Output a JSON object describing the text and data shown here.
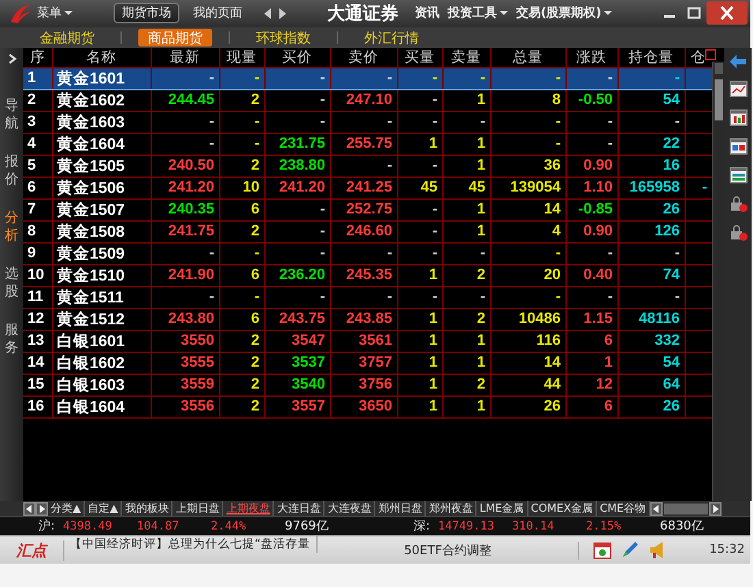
{
  "title_bar": {
    "menu_button": "菜单",
    "tabs": [
      {
        "label": "期货市场",
        "selected": true
      },
      {
        "label": "我的页面",
        "selected": false
      }
    ],
    "title": "大通证券",
    "menus": [
      {
        "label": "资讯",
        "dropdown": false
      },
      {
        "label": "投资工具",
        "dropdown": true
      },
      {
        "label": "交易(股票期权)",
        "dropdown": true
      }
    ]
  },
  "category_tabs": [
    {
      "label": "金融期货",
      "selected": false
    },
    {
      "label": "商品期货",
      "selected": true
    },
    {
      "label": "环球指数",
      "selected": false
    },
    {
      "label": "外汇行情",
      "selected": false
    }
  ],
  "sidebar": {
    "items": [
      {
        "label": "导航",
        "selected": false
      },
      {
        "label": "报价",
        "selected": false
      },
      {
        "label": "分析",
        "selected": true
      },
      {
        "label": "选股",
        "selected": false
      },
      {
        "label": "服务",
        "selected": false
      }
    ]
  },
  "table": {
    "columns": [
      {
        "label": "序",
        "kind": "index"
      },
      {
        "label": "名称",
        "kind": "name"
      },
      {
        "label": "最新",
        "kind": "price"
      },
      {
        "label": "现量",
        "kind": "volume"
      },
      {
        "label": "买价",
        "kind": "price"
      },
      {
        "label": "卖价",
        "kind": "price"
      },
      {
        "label": "买量",
        "kind": "volume"
      },
      {
        "label": "卖量",
        "kind": "volume"
      },
      {
        "label": "总量",
        "kind": "volume"
      },
      {
        "label": "涨跌",
        "kind": "price"
      },
      {
        "label": "持仓量",
        "kind": "holding"
      },
      {
        "label": "仓",
        "kind": "holding"
      }
    ],
    "rows": [
      {
        "selected": true,
        "cells": [
          {
            "text": "1"
          },
          {
            "text": "黄金1601"
          },
          {
            "text": "-"
          },
          {
            "text": "-"
          },
          {
            "text": "-"
          },
          {
            "text": "-"
          },
          {
            "text": "-"
          },
          {
            "text": "-"
          },
          {
            "text": "-"
          },
          {
            "text": "-"
          },
          {
            "text": "-"
          }
        ]
      },
      {
        "selected": false,
        "cells": [
          {
            "text": "2"
          },
          {
            "text": "黄金1602"
          },
          {
            "text": "244.45",
            "color": "#00e000"
          },
          {
            "text": "2"
          },
          {
            "text": "-",
            "color": "#c8c8c8"
          },
          {
            "text": "247.10",
            "color": "#ff3a3a"
          },
          {
            "text": "-",
            "color": "#c8c8c8"
          },
          {
            "text": "1"
          },
          {
            "text": "8"
          },
          {
            "text": "-0.50",
            "color": "#00e000"
          },
          {
            "text": "54"
          }
        ]
      },
      {
        "selected": false,
        "cells": [
          {
            "text": "3"
          },
          {
            "text": "黄金1603"
          },
          {
            "text": "-",
            "color": "#c8c8c8"
          },
          {
            "text": "-"
          },
          {
            "text": "-",
            "color": "#c8c8c8"
          },
          {
            "text": "-",
            "color": "#c8c8c8"
          },
          {
            "text": "-",
            "color": "#c8c8c8"
          },
          {
            "text": "-",
            "color": "#c8c8c8"
          },
          {
            "text": "-"
          },
          {
            "text": "-",
            "color": "#c8c8c8"
          },
          {
            "text": "-",
            "color": "#c8c8c8"
          }
        ]
      },
      {
        "selected": false,
        "cells": [
          {
            "text": "4"
          },
          {
            "text": "黄金1604"
          },
          {
            "text": "-",
            "color": "#c8c8c8"
          },
          {
            "text": "-"
          },
          {
            "text": "231.75",
            "color": "#00e000"
          },
          {
            "text": "255.75",
            "color": "#ff3a3a"
          },
          {
            "text": "1"
          },
          {
            "text": "1"
          },
          {
            "text": "-"
          },
          {
            "text": "-",
            "color": "#c8c8c8"
          },
          {
            "text": "22"
          }
        ]
      },
      {
        "selected": false,
        "cells": [
          {
            "text": "5"
          },
          {
            "text": "黄金1505"
          },
          {
            "text": "240.50",
            "color": "#ff3a3a"
          },
          {
            "text": "2"
          },
          {
            "text": "238.80",
            "color": "#00e000"
          },
          {
            "text": "-",
            "color": "#c8c8c8"
          },
          {
            "text": "-",
            "color": "#c8c8c8"
          },
          {
            "text": "1"
          },
          {
            "text": "36"
          },
          {
            "text": "0.90",
            "color": "#ff3a3a"
          },
          {
            "text": "16"
          }
        ]
      },
      {
        "selected": false,
        "cells": [
          {
            "text": "6"
          },
          {
            "text": "黄金1506"
          },
          {
            "text": "241.20",
            "color": "#ff3a3a"
          },
          {
            "text": "10"
          },
          {
            "text": "241.20",
            "color": "#ff3a3a"
          },
          {
            "text": "241.25",
            "color": "#ff3a3a"
          },
          {
            "text": "45"
          },
          {
            "text": "45"
          },
          {
            "text": "139054"
          },
          {
            "text": "1.10",
            "color": "#ff3a3a"
          },
          {
            "text": "165958"
          },
          {
            "text": "-"
          }
        ]
      },
      {
        "selected": false,
        "cells": [
          {
            "text": "7"
          },
          {
            "text": "黄金1507"
          },
          {
            "text": "240.35",
            "color": "#00e000"
          },
          {
            "text": "6"
          },
          {
            "text": "-",
            "color": "#c8c8c8"
          },
          {
            "text": "252.75",
            "color": "#ff3a3a"
          },
          {
            "text": "-",
            "color": "#c8c8c8"
          },
          {
            "text": "1"
          },
          {
            "text": "14"
          },
          {
            "text": "-0.85",
            "color": "#00e000"
          },
          {
            "text": "26"
          }
        ]
      },
      {
        "selected": false,
        "cells": [
          {
            "text": "8"
          },
          {
            "text": "黄金1508"
          },
          {
            "text": "241.75",
            "color": "#ff3a3a"
          },
          {
            "text": "2"
          },
          {
            "text": "-",
            "color": "#c8c8c8"
          },
          {
            "text": "246.60",
            "color": "#ff3a3a"
          },
          {
            "text": "-",
            "color": "#c8c8c8"
          },
          {
            "text": "1"
          },
          {
            "text": "4"
          },
          {
            "text": "0.90",
            "color": "#ff3a3a"
          },
          {
            "text": "126"
          }
        ]
      },
      {
        "selected": false,
        "cells": [
          {
            "text": "9"
          },
          {
            "text": "黄金1509"
          },
          {
            "text": "-",
            "color": "#c8c8c8"
          },
          {
            "text": "-"
          },
          {
            "text": "-",
            "color": "#c8c8c8"
          },
          {
            "text": "-",
            "color": "#c8c8c8"
          },
          {
            "text": "-",
            "color": "#c8c8c8"
          },
          {
            "text": "-",
            "color": "#c8c8c8"
          },
          {
            "text": "-"
          },
          {
            "text": "-",
            "color": "#c8c8c8"
          },
          {
            "text": "-",
            "color": "#c8c8c8"
          }
        ]
      },
      {
        "selected": false,
        "cells": [
          {
            "text": "10"
          },
          {
            "text": "黄金1510"
          },
          {
            "text": "241.90",
            "color": "#ff3a3a"
          },
          {
            "text": "6"
          },
          {
            "text": "236.20",
            "color": "#00e000"
          },
          {
            "text": "245.35",
            "color": "#ff3a3a"
          },
          {
            "text": "1"
          },
          {
            "text": "2"
          },
          {
            "text": "20"
          },
          {
            "text": "0.40",
            "color": "#ff3a3a"
          },
          {
            "text": "74"
          }
        ]
      },
      {
        "selected": false,
        "cells": [
          {
            "text": "11"
          },
          {
            "text": "黄金1511"
          },
          {
            "text": "-",
            "color": "#c8c8c8"
          },
          {
            "text": "-"
          },
          {
            "text": "-",
            "color": "#c8c8c8"
          },
          {
            "text": "-",
            "color": "#c8c8c8"
          },
          {
            "text": "-",
            "color": "#c8c8c8"
          },
          {
            "text": "-",
            "color": "#c8c8c8"
          },
          {
            "text": "-"
          },
          {
            "text": "-",
            "color": "#c8c8c8"
          },
          {
            "text": "-",
            "color": "#c8c8c8"
          }
        ]
      },
      {
        "selected": false,
        "cells": [
          {
            "text": "12"
          },
          {
            "text": "黄金1512"
          },
          {
            "text": "243.80",
            "color": "#ff3a3a"
          },
          {
            "text": "6"
          },
          {
            "text": "243.75",
            "color": "#ff3a3a"
          },
          {
            "text": "243.85",
            "color": "#ff3a3a"
          },
          {
            "text": "1"
          },
          {
            "text": "2"
          },
          {
            "text": "10486"
          },
          {
            "text": "1.15",
            "color": "#ff3a3a"
          },
          {
            "text": "48116"
          }
        ]
      },
      {
        "selected": false,
        "cells": [
          {
            "text": "13"
          },
          {
            "text": "白银1601"
          },
          {
            "text": "3550",
            "color": "#ff3a3a"
          },
          {
            "text": "2"
          },
          {
            "text": "3547",
            "color": "#ff3a3a"
          },
          {
            "text": "3561",
            "color": "#ff3a3a"
          },
          {
            "text": "1"
          },
          {
            "text": "1"
          },
          {
            "text": "116"
          },
          {
            "text": "6",
            "color": "#ff3a3a"
          },
          {
            "text": "332"
          }
        ]
      },
      {
        "selected": false,
        "cells": [
          {
            "text": "14"
          },
          {
            "text": "白银1602"
          },
          {
            "text": "3555",
            "color": "#ff3a3a"
          },
          {
            "text": "2"
          },
          {
            "text": "3537",
            "color": "#00e000"
          },
          {
            "text": "3757",
            "color": "#ff3a3a"
          },
          {
            "text": "1"
          },
          {
            "text": "1"
          },
          {
            "text": "14"
          },
          {
            "text": "1",
            "color": "#ff3a3a"
          },
          {
            "text": "54"
          }
        ]
      },
      {
        "selected": false,
        "cells": [
          {
            "text": "15"
          },
          {
            "text": "白银1603"
          },
          {
            "text": "3559",
            "color": "#ff3a3a"
          },
          {
            "text": "2"
          },
          {
            "text": "3540",
            "color": "#00e000"
          },
          {
            "text": "3756",
            "color": "#ff3a3a"
          },
          {
            "text": "1"
          },
          {
            "text": "2"
          },
          {
            "text": "44"
          },
          {
            "text": "12",
            "color": "#ff3a3a"
          },
          {
            "text": "64"
          }
        ]
      },
      {
        "selected": false,
        "cells": [
          {
            "text": "16"
          },
          {
            "text": "白银1604"
          },
          {
            "text": "3556",
            "color": "#ff3a3a"
          },
          {
            "text": "2"
          },
          {
            "text": "3557",
            "color": "#ff3a3a"
          },
          {
            "text": "3650",
            "color": "#ff3a3a"
          },
          {
            "text": "1"
          },
          {
            "text": "1"
          },
          {
            "text": "26"
          },
          {
            "text": "6",
            "color": "#ff3a3a"
          },
          {
            "text": "26"
          }
        ]
      }
    ]
  },
  "market_tabs": [
    {
      "label": "分类▲",
      "selected": false
    },
    {
      "label": "自定▲",
      "selected": false
    },
    {
      "label": "我的板块",
      "selected": false
    },
    {
      "label": "上期日盘",
      "selected": false
    },
    {
      "label": "上期夜盘",
      "selected": true
    },
    {
      "label": "大连日盘",
      "selected": false
    },
    {
      "label": "大连夜盘",
      "selected": false
    },
    {
      "label": "郑州日盘",
      "selected": false
    },
    {
      "label": "郑州夜盘",
      "selected": false
    },
    {
      "label": "LME金属",
      "selected": false
    },
    {
      "label": "COMEX金属",
      "selected": false
    },
    {
      "label": "CME谷物",
      "selected": false
    }
  ],
  "index_bar": [
    {
      "label": "沪:",
      "color": "#ff3a3a",
      "values": [
        "4398.49",
        "104.87",
        "2.44%"
      ],
      "turnover": "9769亿"
    },
    {
      "label": "深:",
      "color": "#ff3a3a",
      "values": [
        "14749.13",
        "310.14",
        "2.15%"
      ],
      "turnover": "6830亿"
    }
  ],
  "status_bar": {
    "brand": "汇点",
    "news": "【中国经济时评】总理为什么七提“盘活存量",
    "notice": "50ETF合约调整",
    "time": "15:32"
  }
}
